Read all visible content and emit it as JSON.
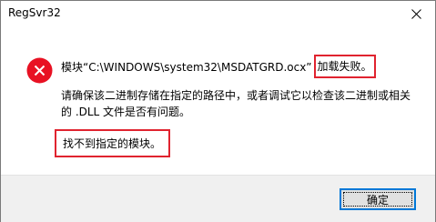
{
  "window": {
    "title": "RegSvr32"
  },
  "icons": {
    "close": "close-icon",
    "error": "error-icon"
  },
  "message": {
    "prefix": "模块“C:\\WINDOWS\\system32\\MSDATGRD.ocx”",
    "failed": "加载失败。",
    "detail": "请确保该二进制存储在指定的路径中，或者调试它以检查该二进制或相关的 .DLL 文件是否有问题。",
    "error": "找不到指定的模块。"
  },
  "buttons": {
    "ok": "确定"
  },
  "colors": {
    "highlight": "#e0232f",
    "error_icon": "#e81123",
    "button_focus": "#0078d7"
  }
}
